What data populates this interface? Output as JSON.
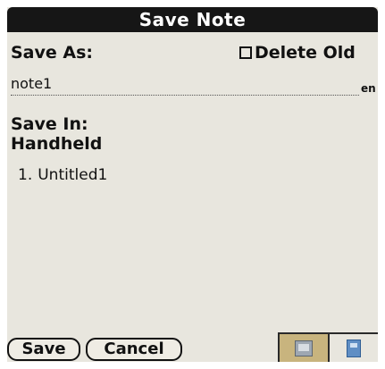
{
  "dialog": {
    "title": "Save Note",
    "save_as_label": "Save As:",
    "delete_old_label": "Delete Old",
    "delete_old_checked": false,
    "note_name_value": "note1",
    "input_mode_indicator": "en",
    "save_in_label": "Save In:",
    "location_label": "Handheld",
    "notes": [
      {
        "index": "1.",
        "name": "Untitled1"
      }
    ],
    "buttons": {
      "save": "Save",
      "cancel": "Cancel"
    },
    "storage_toggle": {
      "active": "handheld",
      "icons": [
        "handheld-icon",
        "card-icon"
      ]
    }
  },
  "colors": {
    "title_bar": "#161616",
    "background": "#e8e6de",
    "active_segment": "#c8b47e"
  }
}
